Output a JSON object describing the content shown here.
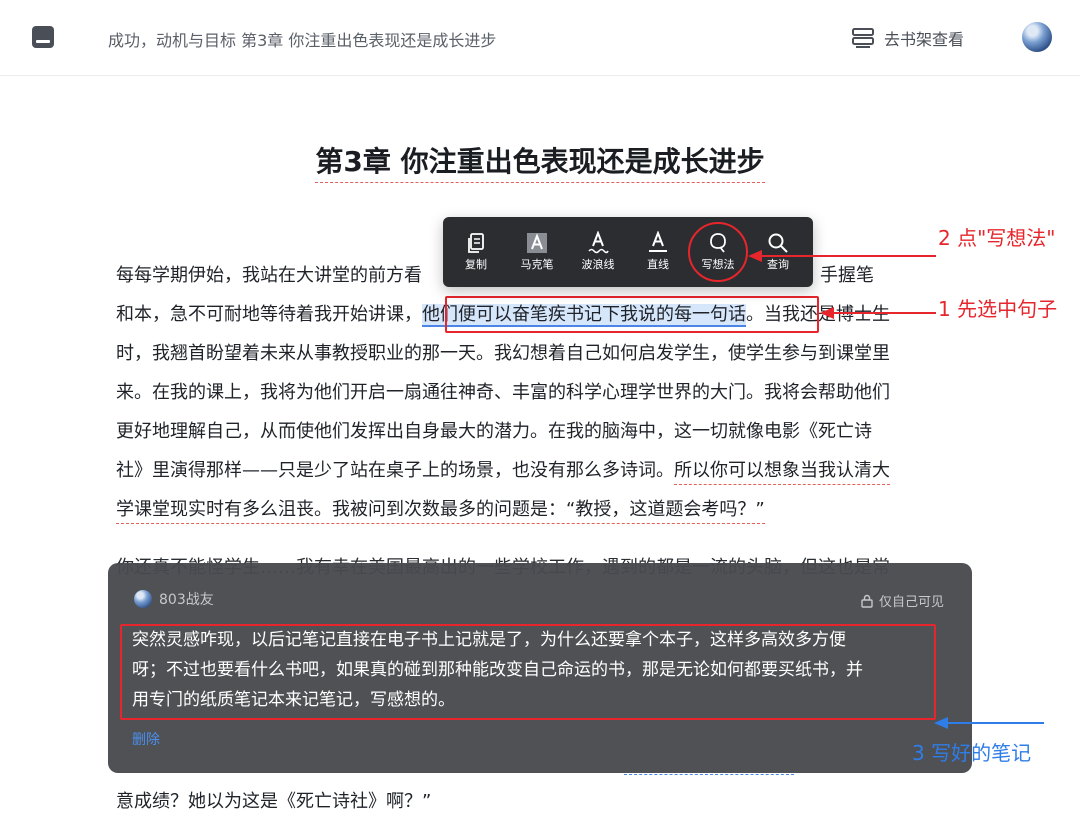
{
  "header": {
    "breadcrumb": "成功，动机与目标 第3章 你注重出色表现还是成长进步",
    "shelf_label": "去书架查看",
    "menu_icon": "book-menu-icon",
    "shelf_icon": "bookshelf-icon"
  },
  "chapter": {
    "title": "第3章 你注重出色表现还是成长进步"
  },
  "paragraph1": {
    "line1": "每每学期伊始，我站在大讲堂的前方看",
    "line1_end": "他们坐着，手握笔",
    "line2_a": "和本，急不可耐地等待着我开始讲课，",
    "line2_sel": "他们便可以奋笔疾书记下我说的每一句话",
    "line2_b": "。当我还是博士生",
    "line3": "时，我翘首盼望着未来从事教授职业的那一天。我幻想着自己如何启发学生，使学生参与到课堂里",
    "line4": "来。在我的课上，我将为他们开启一扇通往神奇、丰富的科学心理学世界的大门。我将会帮助他们",
    "line5": "更好地理解自己，从而使他们发挥出自身最大的潜力。在我的脑海中，这一切就像电影《死亡诗",
    "line6_a": "社》里演得那样——只是少了站在桌子上的场景，也没有那么多诗词。",
    "line6_b": "所以你可以想象当我认清大",
    "line7": "学课堂现实时有多么沮丧。我被问到次数最多的问题是：“教授，这道题会考吗？”"
  },
  "paragraph2": {
    "line_hidden": "你还真不能怪学生……我有幸在美国最高出的一些学校工作，遇到的都是一流的头脑，但这也是常",
    "line_last": "意成绩？她以为这是《死亡诗社》啊？”"
  },
  "toolbar": {
    "items": [
      {
        "label": "复制",
        "icon": "copy-icon"
      },
      {
        "label": "马克笔",
        "icon": "marker-icon"
      },
      {
        "label": "波浪线",
        "icon": "wavy-line-icon"
      },
      {
        "label": "直线",
        "icon": "straight-line-icon"
      },
      {
        "label": "写想法",
        "icon": "write-thought-icon"
      },
      {
        "label": "查询",
        "icon": "search-icon"
      }
    ]
  },
  "annotations": {
    "step1": "1 先选中句子",
    "step2": "2 点\"写想法\"",
    "step3": "3 写好的笔记"
  },
  "note": {
    "user": "803战友",
    "privacy": "仅自己可见",
    "line1": "突然灵感咋现，以后记笔记直接在电子书上记就是了，为什么还要拿个本子，这样多高效多方便",
    "line2": "呀；不过也要看什么书吧，如果真的碰到那种能改变自己命运的书，那是无论如何都要买纸书，并",
    "line3": "用专门的纸质笔记本来记笔记，写感想的。",
    "delete_label": "删除"
  },
  "colors": {
    "annotation_red": "#e6262c",
    "annotation_blue": "#2f7de8",
    "selection": "#d6e6fb",
    "toolbar_bg": "#2b2d31",
    "note_bg": "#484a4e",
    "link_blue": "#4b8fef"
  }
}
